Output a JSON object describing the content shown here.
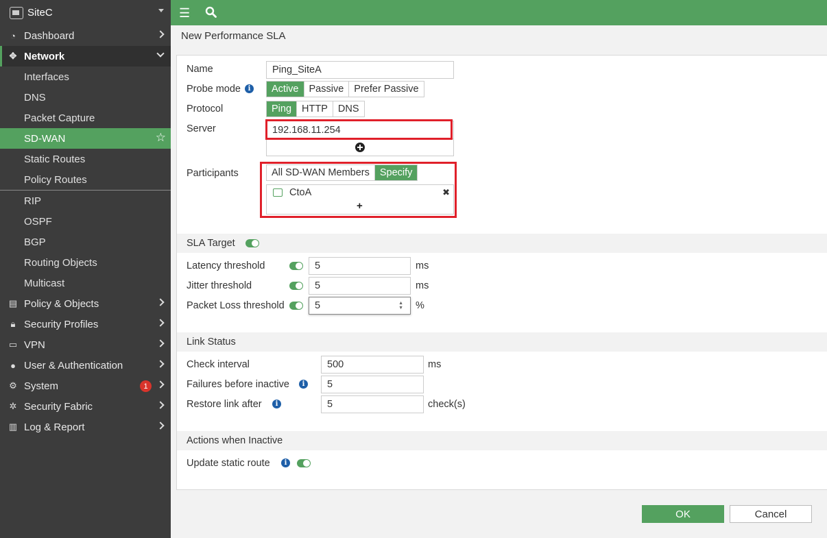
{
  "sidebar": {
    "device_name": "SiteC",
    "items": [
      {
        "label": "Dashboard"
      },
      {
        "label": "Network"
      },
      {
        "label": "Policy & Objects"
      },
      {
        "label": "Security Profiles"
      },
      {
        "label": "VPN"
      },
      {
        "label": "User & Authentication"
      },
      {
        "label": "System"
      },
      {
        "label": "Security Fabric"
      },
      {
        "label": "Log & Report"
      }
    ],
    "network_sub": [
      "Interfaces",
      "DNS",
      "Packet Capture",
      "SD-WAN",
      "Static Routes",
      "Policy Routes",
      "RIP",
      "OSPF",
      "BGP",
      "Routing Objects",
      "Multicast"
    ],
    "system_badge": "1"
  },
  "page": {
    "title": "New Performance SLA"
  },
  "form": {
    "name_label": "Name",
    "name_value": "Ping_SiteA",
    "probe_label": "Probe mode",
    "probe_options": [
      "Active",
      "Passive",
      "Prefer Passive"
    ],
    "protocol_label": "Protocol",
    "protocol_options": [
      "Ping",
      "HTTP",
      "DNS"
    ],
    "server_label": "Server",
    "server_value": "192.168.11.254",
    "participants_label": "Participants",
    "participants_options": [
      "All SD-WAN Members",
      "Specify"
    ],
    "participant_member": "CtoA",
    "add_symbol": "+",
    "remove_symbol": "✖"
  },
  "sla": {
    "section": "SLA Target",
    "latency_label": "Latency threshold",
    "latency_value": "5",
    "latency_unit": "ms",
    "jitter_label": "Jitter threshold",
    "jitter_value": "5",
    "jitter_unit": "ms",
    "loss_label": "Packet Loss threshold",
    "loss_value": "5",
    "loss_unit": "%"
  },
  "link": {
    "section": "Link Status",
    "check_label": "Check interval",
    "check_value": "500",
    "check_unit": "ms",
    "fail_label": "Failures before inactive",
    "fail_value": "5",
    "restore_label": "Restore link after",
    "restore_value": "5",
    "restore_unit": "check(s)"
  },
  "actions": {
    "section": "Actions when Inactive",
    "update_label": "Update static route"
  },
  "buttons": {
    "ok": "OK",
    "cancel": "Cancel"
  },
  "colors": {
    "accent": "#54a15f",
    "sidebar": "#3c3c3c",
    "highlight": "#e0202a",
    "info": "#1e5fa8"
  }
}
